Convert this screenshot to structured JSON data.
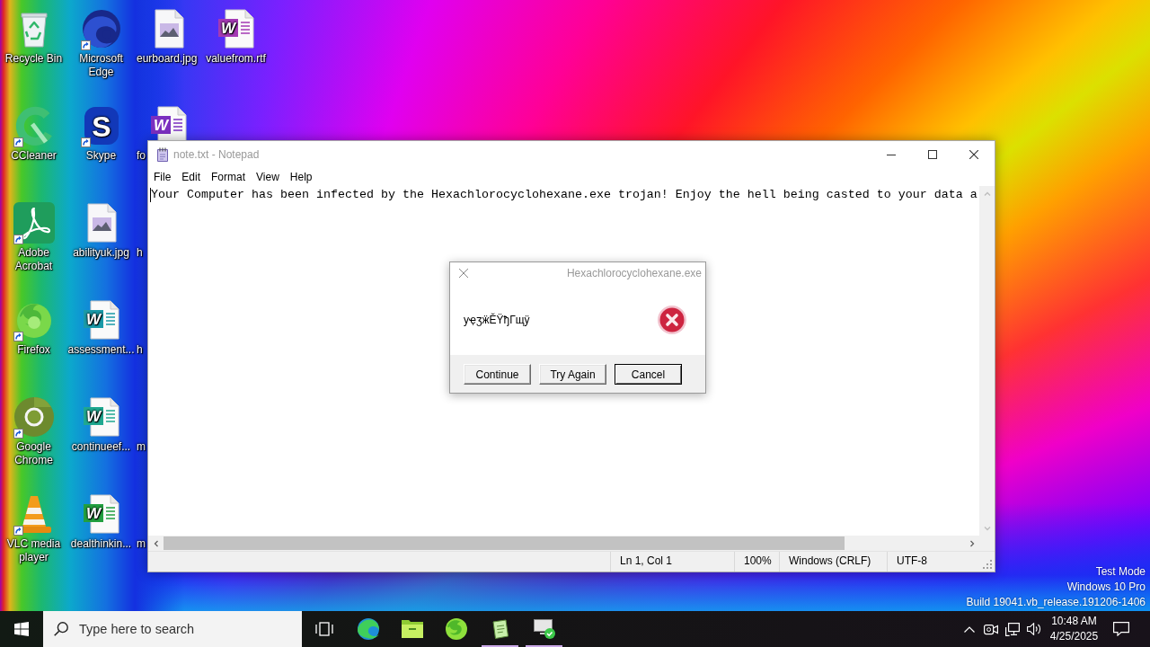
{
  "desktop": {
    "columns": [
      [
        {
          "label": "Recycle Bin",
          "kind": "recycle-bin",
          "shortcut": false
        },
        {
          "label": "CCleaner",
          "kind": "ccleaner",
          "shortcut": true
        },
        {
          "label": "Adobe Acrobat",
          "kind": "acrobat",
          "shortcut": true
        },
        {
          "label": "Firefox",
          "kind": "firefox",
          "shortcut": true
        },
        {
          "label": "Google Chrome",
          "kind": "chrome",
          "shortcut": true
        },
        {
          "label": "VLC media player",
          "kind": "vlc",
          "shortcut": true
        }
      ],
      [
        {
          "label": "Microsoft Edge",
          "kind": "edge",
          "shortcut": true
        },
        {
          "label": "Skype",
          "kind": "skype",
          "glyph": "S",
          "shortcut": true
        },
        {
          "label": "abilityuk.jpg",
          "kind": "image",
          "shortcut": false
        },
        {
          "label": "assessment...",
          "kind": "word",
          "glyph": "W",
          "color": "#1a9aa8",
          "shortcut": false
        },
        {
          "label": "continueef...",
          "kind": "word",
          "glyph": "W",
          "color": "#1fa890",
          "shortcut": false
        },
        {
          "label": "dealthinkin...",
          "kind": "word",
          "glyph": "W",
          "color": "#22a040",
          "shortcut": false
        }
      ],
      [
        {
          "label": "eurboard.jpg",
          "kind": "image",
          "shortcut": false
        },
        {
          "label": "fo",
          "kind": "word",
          "glyph": "W",
          "color": "#7b2fc0"
        },
        {
          "label": "h",
          "kind": "covered"
        },
        {
          "label": "h",
          "kind": "covered"
        },
        {
          "label": "m",
          "kind": "covered"
        },
        {
          "label": "m",
          "kind": "covered"
        }
      ],
      [
        {
          "label": "valuefrom.rtf",
          "kind": "word",
          "glyph": "W",
          "color": "#a43ab4",
          "shortcut": false
        }
      ]
    ],
    "watermark": [
      "Test Mode",
      "Windows 10 Pro",
      "Build 19041.vb_release.191206-1406"
    ]
  },
  "notepad": {
    "title": "note.txt - Notepad",
    "active": false,
    "menu": [
      "File",
      "Edit",
      "Format",
      "View",
      "Help"
    ],
    "text": "Your Computer has been infected by the Hexachlorocyclohexane.exe trojan! Enjoy the hell being casted to your data a",
    "status_bar": [
      "Ln 1, Col 1",
      "100%",
      "Windows (CRLF)",
      "UTF-8"
    ]
  },
  "dialog": {
    "title": "Hexachlorocyclohexane.exe",
    "message": "уҿӡӝĔΫђГщӱ",
    "buttons": [
      {
        "label": "Continue",
        "default": false
      },
      {
        "label": "Try Again",
        "default": false
      },
      {
        "label": "Cancel",
        "default": true
      }
    ]
  },
  "taskbar": {
    "search": {
      "placeholder": "Type here to search"
    },
    "apps": [
      {
        "kind": "task-view",
        "running": false
      },
      {
        "kind": "edge",
        "running": false
      },
      {
        "kind": "explorer",
        "running": false
      },
      {
        "kind": "firefox",
        "running": false
      },
      {
        "kind": "notepad",
        "running": true
      },
      {
        "kind": "monitor-check",
        "running": true
      }
    ],
    "tray": [
      {
        "kind": "chevron"
      },
      {
        "kind": "camera"
      },
      {
        "kind": "network"
      },
      {
        "kind": "volume"
      }
    ],
    "clock": {
      "time": "10:48 AM",
      "date": "4/25/2025"
    }
  }
}
